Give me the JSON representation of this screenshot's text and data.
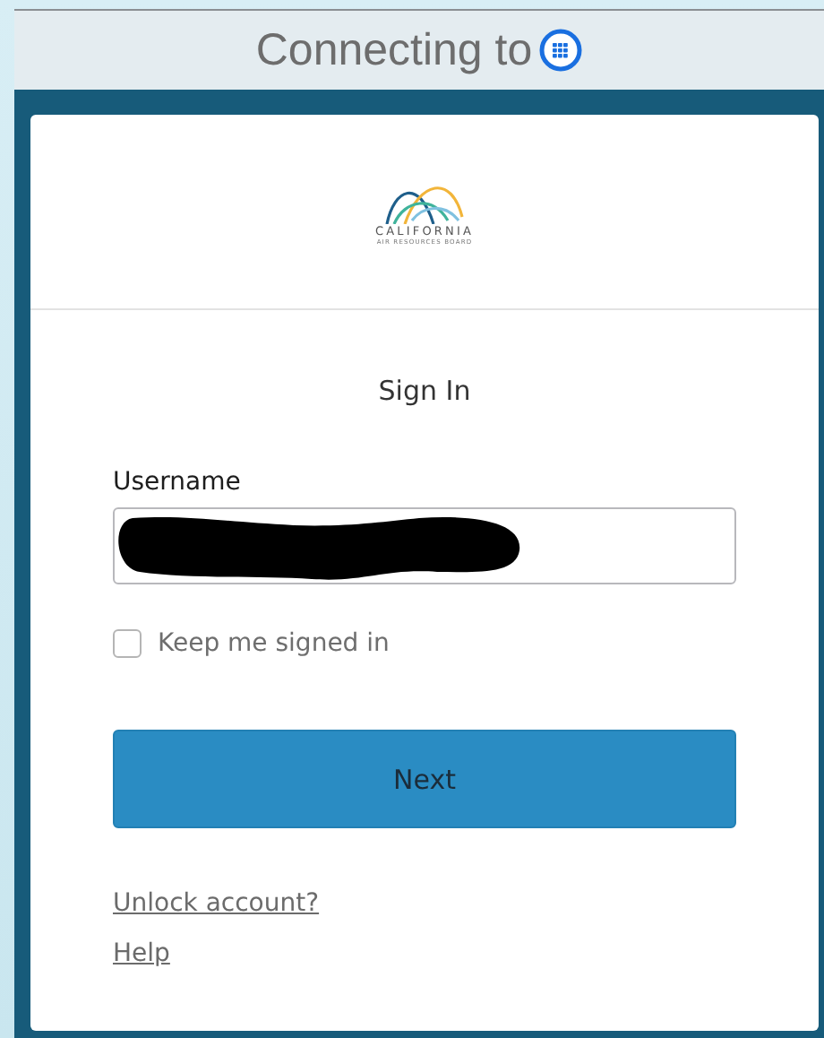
{
  "header": {
    "title": "Connecting to"
  },
  "logo": {
    "name": "CALIFORNIA",
    "subtitle": "AIR RESOURCES BOARD"
  },
  "form": {
    "title": "Sign In",
    "username_label": "Username",
    "username_redacted": true,
    "remember": {
      "label": "Keep me signed in",
      "checked": false
    },
    "submit": "Next",
    "links": [
      "Unlock account?",
      "Help"
    ]
  }
}
